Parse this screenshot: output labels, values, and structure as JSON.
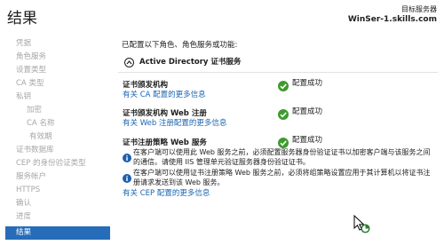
{
  "header": {
    "title": "结果",
    "server_label": "目标服务器",
    "server_name": "WinSer-1.skills.com"
  },
  "nav": {
    "items": [
      {
        "label": "凭据"
      },
      {
        "label": "角色服务"
      },
      {
        "label": "设置类型"
      },
      {
        "label": "CA 类型"
      },
      {
        "label": "私钥"
      },
      {
        "label": "加密"
      },
      {
        "label": "CA 名称"
      },
      {
        "label": "有效期"
      },
      {
        "label": "证书数据库"
      },
      {
        "label": "CEP 的身份验证类型"
      },
      {
        "label": "服务帐户"
      },
      {
        "label": "HTTPS"
      },
      {
        "label": "确认"
      },
      {
        "label": "进度"
      }
    ],
    "active_label": "结果"
  },
  "main": {
    "description": "已配置以下角色、角色服务或功能:",
    "section_title": "Active Directory 证书服务",
    "roles": [
      {
        "name": "证书颁发机构",
        "link": "有关 CA 配置的更多信息",
        "status": "配置成功"
      },
      {
        "name": "证书颁发机构 Web 注册",
        "link": "有关 Web 注册配置的更多信息",
        "status": "配置成功"
      },
      {
        "name": "证书注册策略 Web 服务",
        "status": "配置成功"
      }
    ],
    "notes": [
      "在客户端可以使用此 Web 服务之前，必须配置服务器身份验证证书以加密客户端与该服务之间的通信。请使用 IIS 管理单元验证服务器身份验证证书。",
      "在客户端可以使用证书注册策略 Web 服务之前，必须将组策略设置应用于其计算机以将证书注册请求发送到该 Web 服务。"
    ],
    "cep_link": "有关 CEP 配置的更多信息"
  },
  "colors": {
    "accent": "#276cb9",
    "link": "#1a66b3",
    "success": "#3e9b2f",
    "info": "#1f5fae"
  }
}
